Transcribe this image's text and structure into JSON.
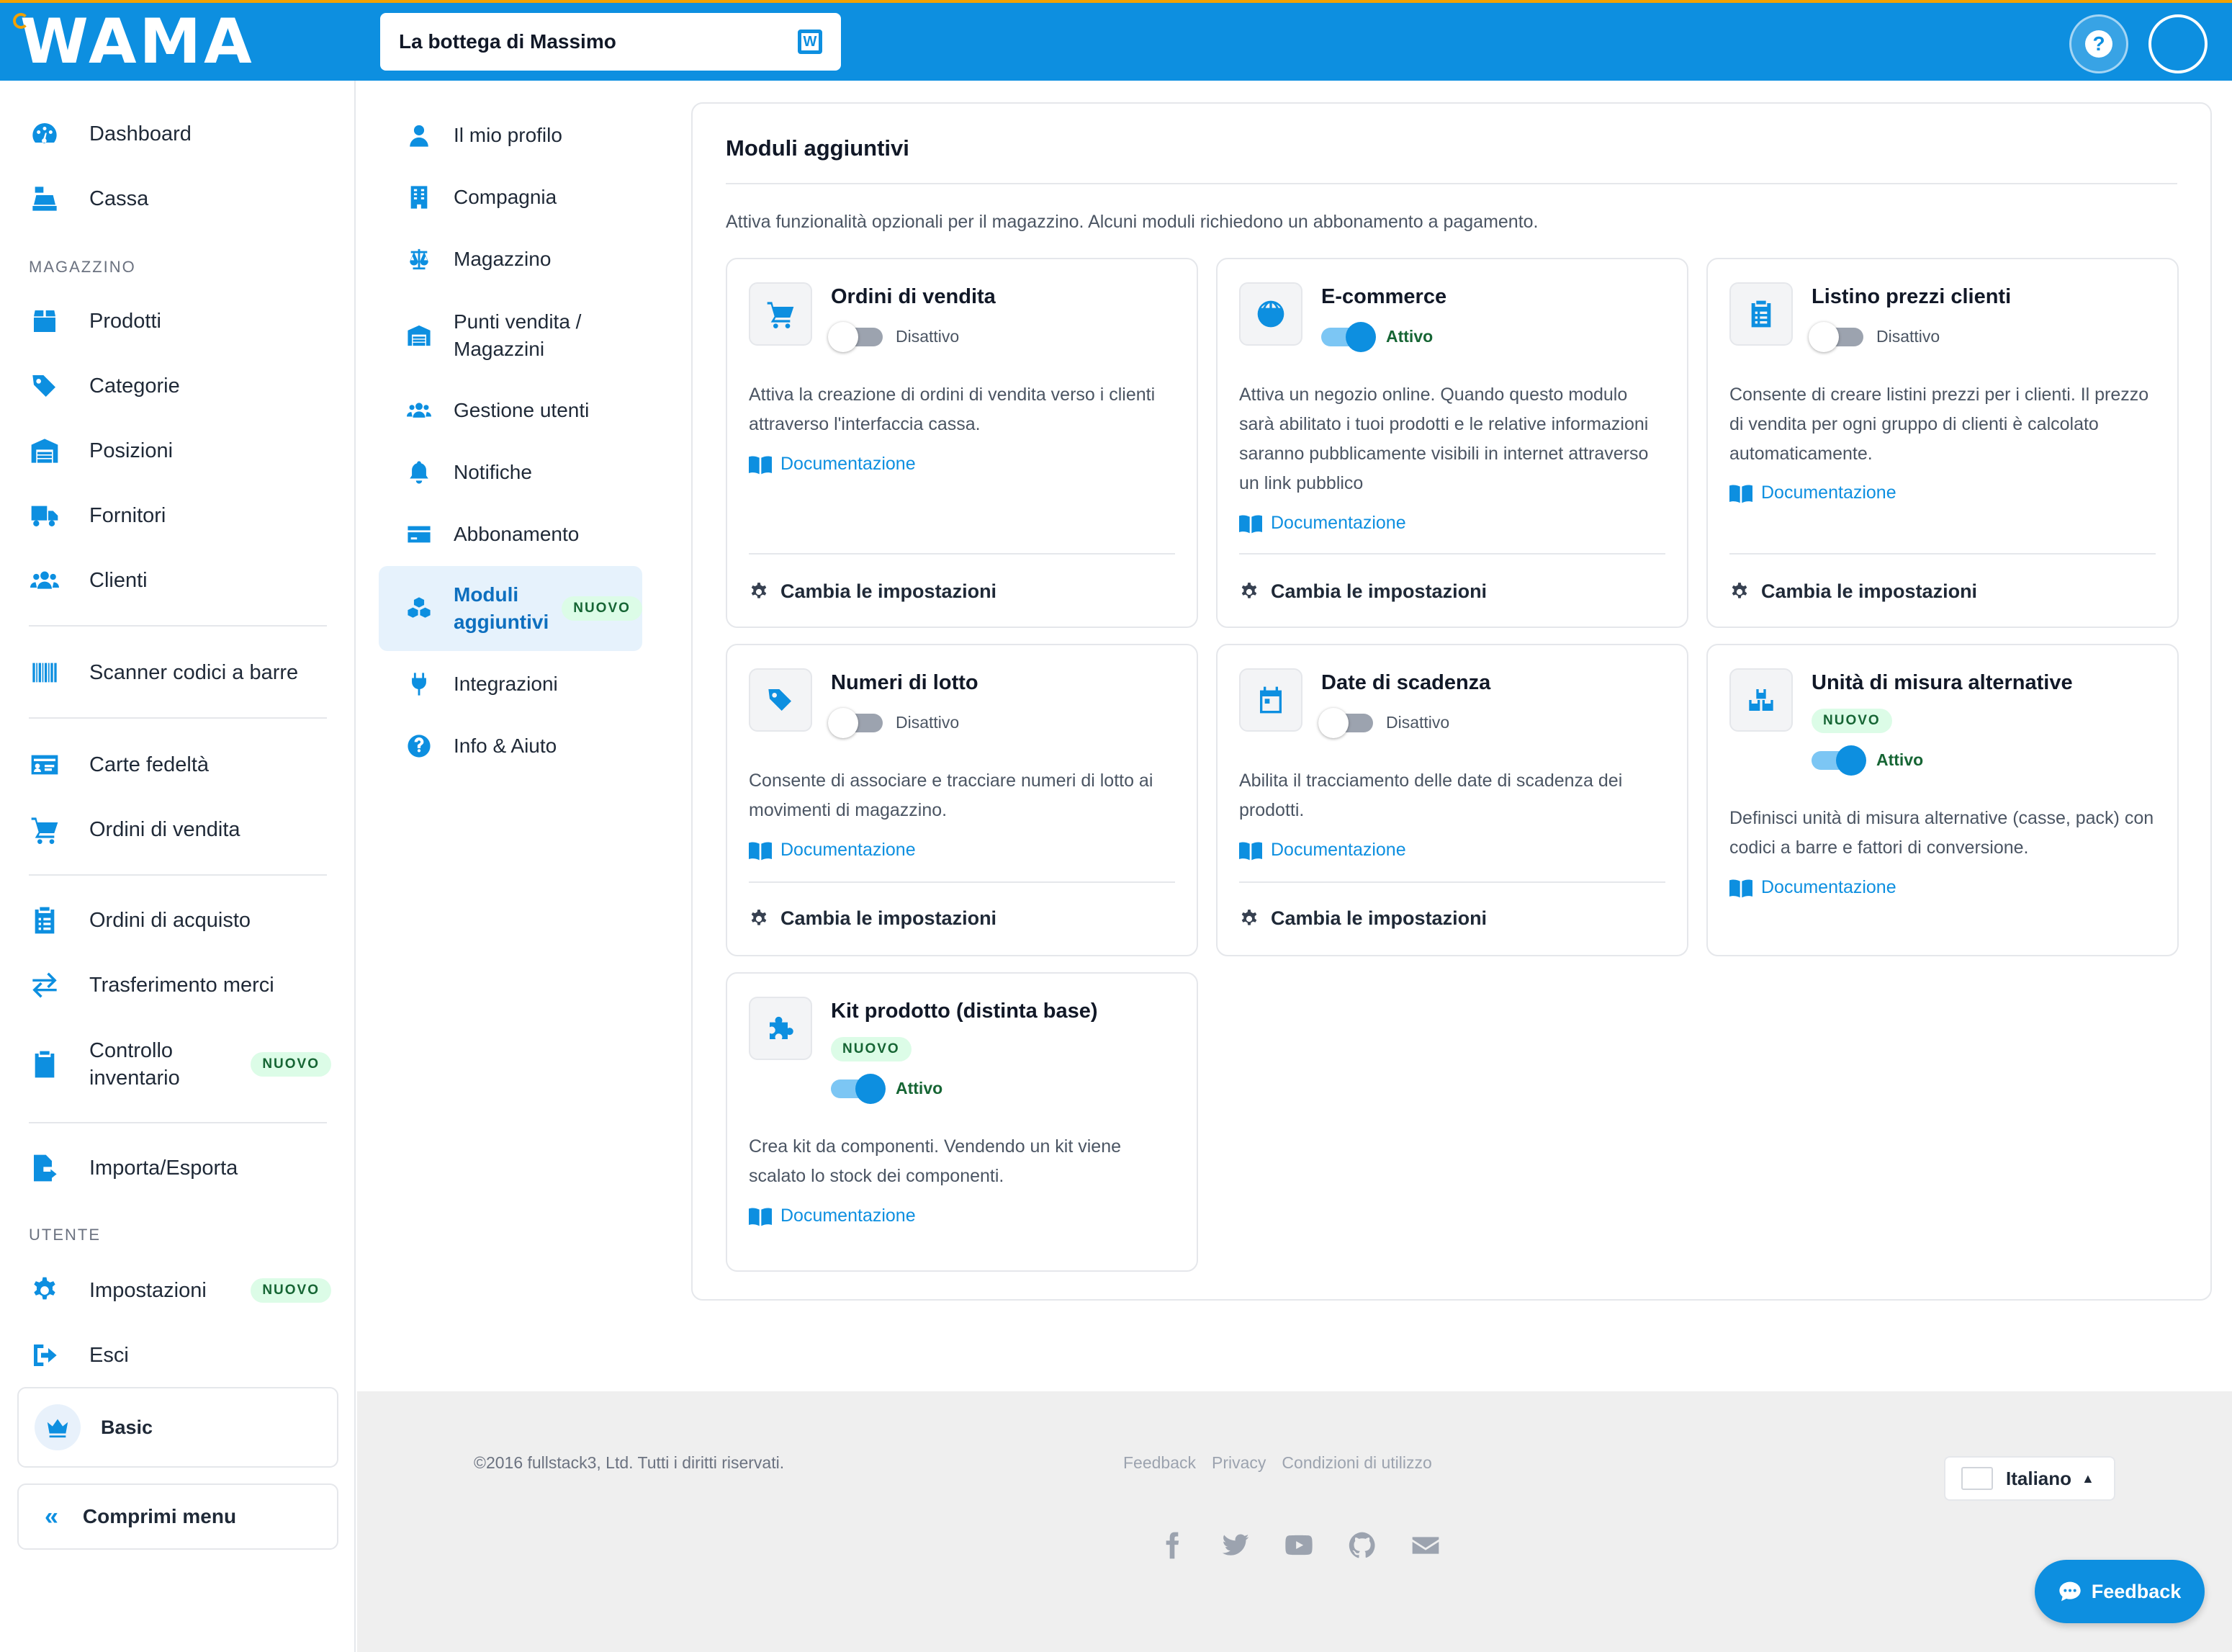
{
  "app": {
    "logo": "WAMA",
    "store_name": "La bottega di Massimo",
    "store_icon_letter": "W",
    "accent": "#0d8fe0"
  },
  "sidebar": {
    "items": [
      {
        "label": "Dashboard",
        "icon": "dashboard-icon"
      },
      {
        "label": "Cassa",
        "icon": "cash-register-icon"
      },
      {
        "label": "Prodotti",
        "icon": "box-icon"
      },
      {
        "label": "Categorie",
        "icon": "tags-icon"
      },
      {
        "label": "Posizioni",
        "icon": "warehouse-icon"
      },
      {
        "label": "Fornitori",
        "icon": "truck-icon"
      },
      {
        "label": "Clienti",
        "icon": "users-icon"
      },
      {
        "label": "Scanner codici a barre",
        "icon": "barcode-icon"
      },
      {
        "label": "Carte fedeltà",
        "icon": "id-card-icon"
      },
      {
        "label": "Ordini di vendita",
        "icon": "cart-icon"
      },
      {
        "label": "Ordini di acquisto",
        "icon": "clipboard-list-icon"
      },
      {
        "label": "Trasferimento merci",
        "icon": "transfer-icon"
      },
      {
        "label": "Controllo inventario",
        "icon": "clipboard-check-icon",
        "badge": "NUOVO"
      },
      {
        "label": "Importa/Esporta",
        "icon": "file-export-icon"
      },
      {
        "label": "Impostazioni",
        "icon": "gear-icon",
        "badge": "NUOVO"
      },
      {
        "label": "Esci",
        "icon": "sign-out-icon"
      }
    ],
    "section_magazzino": "MAGAZZINO",
    "section_utente": "UTENTE",
    "plan": "Basic",
    "collapse": "Comprimi menu"
  },
  "subnav": {
    "items": [
      {
        "label": "Il mio profilo",
        "icon": "user-icon"
      },
      {
        "label": "Compagnia",
        "icon": "building-icon"
      },
      {
        "label": "Magazzino",
        "icon": "balance-scale-icon"
      },
      {
        "label": "Punti vendita / Magazzini",
        "icon": "warehouse-icon"
      },
      {
        "label": "Gestione utenti",
        "icon": "users-icon"
      },
      {
        "label": "Notifiche",
        "icon": "bell-icon"
      },
      {
        "label": "Abbonamento",
        "icon": "credit-card-icon"
      },
      {
        "label": "Moduli aggiuntivi",
        "icon": "cubes-icon",
        "badge": "NUOVO",
        "active": true
      },
      {
        "label": "Integrazioni",
        "icon": "plug-icon"
      },
      {
        "label": "Info & Aiuto",
        "icon": "question-circle-icon"
      }
    ]
  },
  "main": {
    "title": "Moduli aggiuntivi",
    "description": "Attiva funzionalità opzionali per il magazzino. Alcuni moduli richiedono un abbonamento a pagamento.",
    "doc_label": "Documentazione",
    "settings_label": "Cambia le impostazioni",
    "new_label": "NUOVO",
    "modules": [
      {
        "title": "Ordini di vendita",
        "status": "Disattivo",
        "active": false,
        "icon": "cart-icon",
        "description": "Attiva la creazione di ordini di vendita verso i clienti attraverso l'interfaccia cassa."
      },
      {
        "title": "E-commerce",
        "status": "Attivo",
        "active": true,
        "icon": "globe-icon",
        "description": "Attiva un negozio online. Quando questo modulo sarà abilitato i tuoi prodotti e le relative informazioni saranno pubblicamente visibili in internet attraverso un link pubblico"
      },
      {
        "title": "Listino prezzi clienti",
        "status": "Disattivo",
        "active": false,
        "icon": "clipboard-list-icon",
        "description": "Consente di creare listini prezzi per i clienti. Il prezzo di vendita per ogni gruppo di clienti è calcolato automaticamente."
      },
      {
        "title": "Numeri di lotto",
        "status": "Disattivo",
        "active": false,
        "icon": "tag-icon",
        "description": "Consente di associare e tracciare numeri di lotto ai movimenti di magazzino."
      },
      {
        "title": "Date di scadenza",
        "status": "Disattivo",
        "active": false,
        "icon": "calendar-icon",
        "description": "Abilita il tracciamento delle date di scadenza dei prodotti."
      },
      {
        "title": "Unità di misura alternative",
        "status": "Attivo",
        "active": true,
        "icon": "boxes-icon",
        "badge": "NUOVO",
        "description": "Definisci unità di misura alternative (casse, pack) con codici a barre e fattori di conversione."
      },
      {
        "title": "Kit prodotto (distinta base)",
        "status": "Attivo",
        "active": true,
        "icon": "puzzle-icon",
        "badge": "NUOVO",
        "description": "Crea kit da componenti. Vendendo un kit viene scalato lo stock dei componenti."
      }
    ]
  },
  "footer": {
    "copyright": "©2016 fullstack3, Ltd. Tutti i diritti riservati.",
    "links": [
      "Feedback",
      "Privacy",
      "Condizioni di utilizzo"
    ],
    "language": "Italiano",
    "socials": [
      "facebook-icon",
      "twitter-icon",
      "youtube-icon",
      "github-icon",
      "envelope-icon"
    ]
  },
  "feedback_button": "Feedback"
}
